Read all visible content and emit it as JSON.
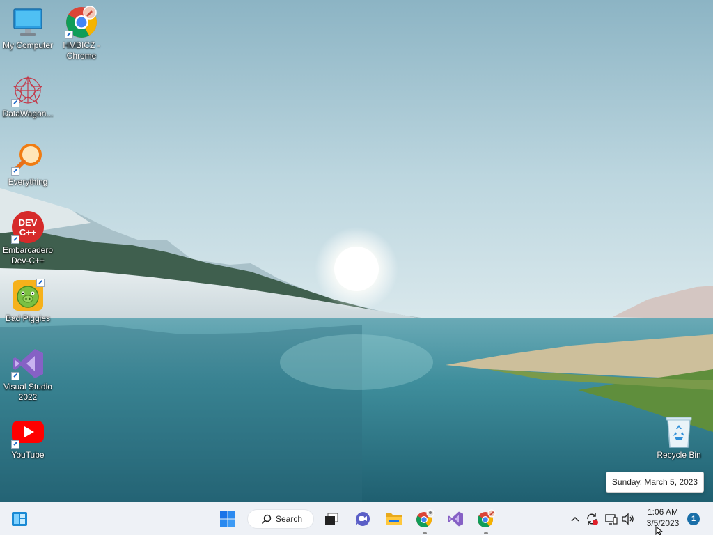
{
  "desktop": {
    "icons": [
      {
        "label": "My Computer",
        "icon": "monitor-icon"
      },
      {
        "label": "HMBICZ - Chrome",
        "icon": "chrome-profile-icon"
      },
      {
        "label": "DataWagon...",
        "icon": "datawagon-icon"
      },
      {
        "label": "Everything",
        "icon": "everything-search-icon"
      },
      {
        "label": "Embarcadero Dev-C++",
        "icon": "devcpp-icon",
        "badge": "DEV C++"
      },
      {
        "label": "Bad Piggies",
        "icon": "bad-piggies-icon"
      },
      {
        "label": "Visual Studio 2022",
        "icon": "visual-studio-icon"
      },
      {
        "label": "YouTube",
        "icon": "youtube-icon"
      },
      {
        "label": "Recycle Bin",
        "icon": "recycle-bin-icon"
      }
    ]
  },
  "tooltip": {
    "text": "Sunday, March 5, 2023"
  },
  "taskbar": {
    "search_label": "Search",
    "clock": {
      "time": "1:06 AM",
      "date": "3/5/2023"
    },
    "notification_count": "1"
  },
  "colors": {
    "taskbar_bg": "#eef1f6",
    "start_blue": "#1a73e8",
    "sky_top": "#8fb6c6",
    "lake": "#2f7f8f"
  }
}
